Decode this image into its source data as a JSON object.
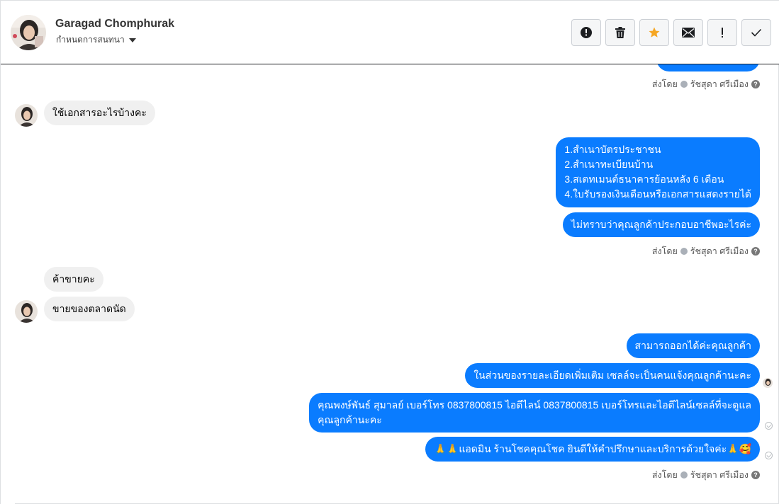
{
  "header": {
    "contact_name": "Garagad Chomphurak",
    "assign_label": "กำหนดการสนทนา",
    "toolbar": [
      {
        "name": "mark-spam-button",
        "icon": "alert-circle-icon"
      },
      {
        "name": "delete-button",
        "icon": "trash-icon"
      },
      {
        "name": "star-button",
        "icon": "star-icon"
      },
      {
        "name": "mark-unread-button",
        "icon": "envelope-icon"
      },
      {
        "name": "follow-up-button",
        "icon": "exclamation-icon"
      },
      {
        "name": "mark-done-button",
        "icon": "checkmark-icon"
      }
    ]
  },
  "colors": {
    "outgoing_bubble": "#0a7cff",
    "incoming_bubble": "#f0f0f0",
    "star": "#f5a623"
  },
  "messages": {
    "sent_by_1": "ส่งโดย",
    "sender_1": "รัชสุดา ศรีเมือง",
    "in_1": "ใช้เอกสารอะไรบ้างคะ",
    "out_docs_1": "1.สำเนาบัตรประชาชน",
    "out_docs_2": "2.สำเนาทะเบียนบ้าน",
    "out_docs_3": "3.สเตทเมนต์ธนาคารย้อนหลัง 6 เดือน",
    "out_docs_4": "4.ใบรับรองเงินเดือนหรือเอกสารแสดงรายได้",
    "out_2": "ไม่ทราบว่าคุณลูกค้าประกอบอาชีพอะไรค่ะ",
    "sent_by_2": "ส่งโดย",
    "sender_2": "รัชสุดา ศรีเมือง",
    "in_2": "ค้าขายคะ",
    "in_3": "ขายของตลาดนัด",
    "out_3": "สามารถออกได้ค่ะคุณลูกค้า",
    "out_4": "ในส่วนของรายละเอียดเพิ่มเติม  เซลล์จะเป็นคนแจ้งคุณลูกค้านะคะ",
    "out_5_line1": "คุณพงษ์พันธ์ สุมาลย์      เบอร์โทร 0837800815  ไอดีไลน์ 0837800815   เบอร์โทรและไอดีไลน์เซลล์ที่จะดูแล",
    "out_5_line2": "คุณลูกค้านะคะ",
    "out_6": "🙏🙏แอดมิน ร้านโชคคุณโชค ยินดีให้คำปรึกษาและบริการด้วยใจค่ะ🙏🥰",
    "sent_by_3": "ส่งโดย",
    "sender_3": "รัชสุดา ศรีเมือง"
  }
}
